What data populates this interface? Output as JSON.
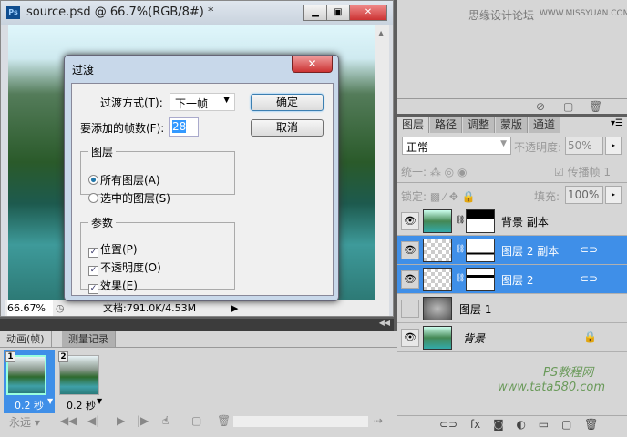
{
  "document": {
    "title": "source.psd @ 66.7%(RGB/8#) *",
    "app_icon": "Ps",
    "zoom": "66.67%",
    "doc_info": "文档:791.0K/4.53M"
  },
  "watermark_top": {
    "text": "思缘设计论坛",
    "url": "WWW.MISSYUAN.COM"
  },
  "dialog": {
    "title": "过渡",
    "method_label": "过渡方式(T):",
    "method_value": "下一帧",
    "frames_label": "要添加的帧数(F):",
    "frames_value": "28",
    "ok": "确定",
    "cancel": "取消",
    "layers_group": {
      "title": "图层",
      "options": [
        "所有图层(A)",
        "选中的图层(S)"
      ],
      "selected": 0
    },
    "params_group": {
      "title": "参数",
      "options": [
        {
          "label": "位置(P)",
          "checked": true
        },
        {
          "label": "不透明度(O)",
          "checked": true
        },
        {
          "label": "效果(E)",
          "checked": true
        }
      ]
    }
  },
  "animation": {
    "tabs": [
      "动画(帧)",
      "测量记录"
    ],
    "frames": [
      {
        "num": "1",
        "delay": "0.2 秒",
        "selected": true
      },
      {
        "num": "2",
        "delay": "0.2 秒",
        "selected": false
      }
    ],
    "loop": "永远"
  },
  "layers_panel": {
    "tabs": [
      "图层",
      "路径",
      "调整",
      "蒙版",
      "通道"
    ],
    "blend_mode": "正常",
    "opacity_label": "不透明度:",
    "opacity": "50%",
    "unify_label": "统一:",
    "propagate_label": "传播帧 1",
    "lock_label": "锁定:",
    "fill_label": "填充:",
    "fill": "100%",
    "layers": [
      {
        "name": "背景 副本",
        "visible": true,
        "selected": false
      },
      {
        "name": "图层 2 副本",
        "visible": true,
        "selected": true
      },
      {
        "name": "图层 2",
        "visible": true,
        "selected": true
      },
      {
        "name": "图层 1",
        "visible": false,
        "selected": false
      },
      {
        "name": "背景",
        "visible": true,
        "selected": false,
        "locked": true
      }
    ]
  },
  "watermark_bottom": {
    "site": "PS教程网",
    "url": "www.tata580.com"
  },
  "colors": {
    "selection": "#3f8fe8",
    "panel": "#d6d6d6"
  }
}
